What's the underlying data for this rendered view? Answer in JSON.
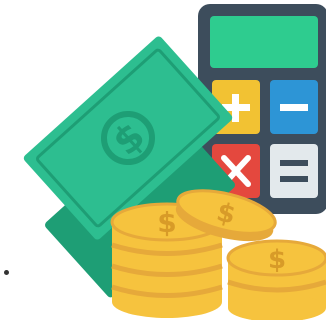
{
  "illustration": {
    "subject": "money-and-calculator",
    "icons": {
      "calculator": "calculator-icon",
      "banknotes": "banknote-icon",
      "coins": "coin-stack-icon",
      "currency": "dollar-sign-icon"
    },
    "currency_symbol": "$",
    "colors": {
      "calculator_body": "#3D4D5C",
      "calculator_screen": "#2ECC8F",
      "key_plus": "#F2C233",
      "key_minus": "#2D95D6",
      "key_times": "#E4483E",
      "key_equals": "#E3E9EC",
      "note_light": "#2DBE90",
      "note_dark": "#1E9E75",
      "coin_face": "#F6C33E",
      "coin_edge": "#E6A93A",
      "coin_symbol": "#D89B28"
    }
  }
}
